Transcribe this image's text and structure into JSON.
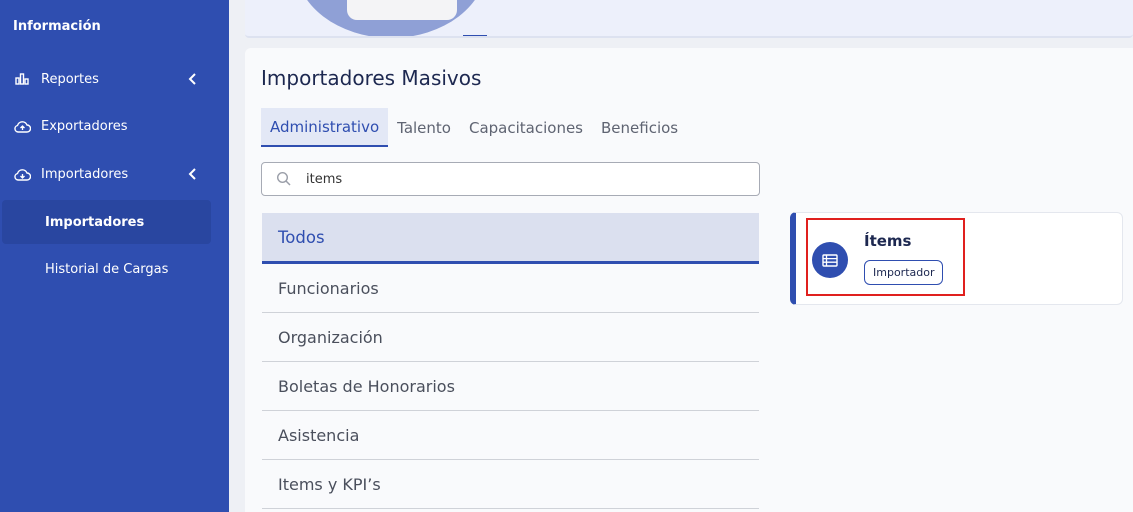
{
  "sidebar": {
    "title": "Información",
    "items": [
      {
        "label": "Reportes",
        "icon": "bar-chart-icon"
      },
      {
        "label": "Exportadores",
        "icon": "cloud-upload-icon"
      },
      {
        "label": "Importadores",
        "icon": "cloud-download-icon"
      }
    ],
    "subitems": [
      {
        "label": "Importadores",
        "active": true
      },
      {
        "label": "Historial de Cargas",
        "active": false
      }
    ]
  },
  "main": {
    "title": "Importadores Masivos",
    "tabs": [
      {
        "label": "Administrativo",
        "active": true
      },
      {
        "label": "Talento"
      },
      {
        "label": "Capacitaciones"
      },
      {
        "label": "Beneficios"
      }
    ],
    "search": {
      "value": "items",
      "icon": "search-icon"
    },
    "categories": [
      {
        "label": "Todos",
        "active": true
      },
      {
        "label": "Funcionarios"
      },
      {
        "label": "Organización"
      },
      {
        "label": "Boletas de Honorarios"
      },
      {
        "label": "Asistencia"
      },
      {
        "label": "Items y KPI’s"
      }
    ]
  },
  "result": {
    "title": "Ítems",
    "badge": "Importador",
    "icon": "list-icon"
  },
  "colors": {
    "primary": "#2f4eb0",
    "highlight": "#e0201e"
  }
}
